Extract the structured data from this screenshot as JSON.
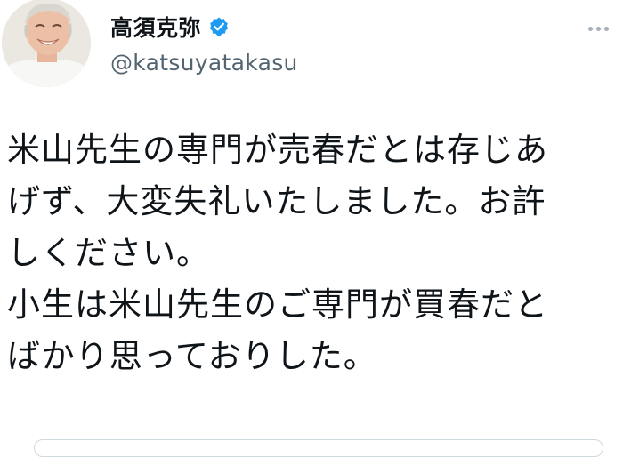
{
  "tweet": {
    "author": {
      "display_name": "高須克弥",
      "handle": "@katsuyatakasu",
      "verified": true
    },
    "more_icon": "more-horizontal-icon",
    "body_lines": [
      "米山先生の専門が売春だとは存じあ",
      "げず、大変失礼いたしました。お許",
      "しください。",
      "小生は米山先生のご専門が買春だと",
      "ばかり思っておりした。"
    ]
  },
  "colors": {
    "text_primary": "#0f1419",
    "text_secondary": "#536471",
    "verified_blue": "#1d9bf0",
    "divider": "#cfd9de"
  }
}
